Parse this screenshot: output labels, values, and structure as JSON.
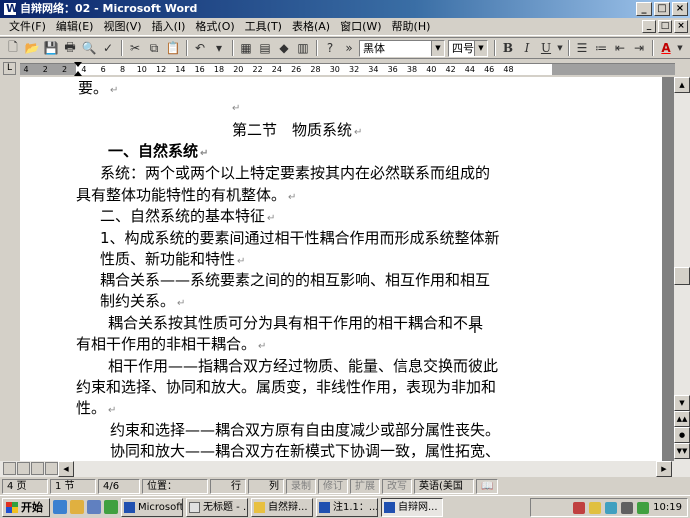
{
  "window": {
    "title": "自辩网络：02 - Microsoft Word",
    "buttons": [
      "_",
      "□",
      "×"
    ]
  },
  "menu": [
    "文件(F)",
    "编辑(E)",
    "视图(V)",
    "插入(I)",
    "格式(O)",
    "工具(T)",
    "表格(A)",
    "窗口(W)",
    "帮助(H)"
  ],
  "doc_buttons": [
    "_",
    "□",
    "×"
  ],
  "toolbar": {
    "font_name": "黑体",
    "font_size": "四号",
    "bold_label": "B",
    "italic_label": "I",
    "underline_label": "U",
    "font_color_label": "A"
  },
  "ruler": {
    "corner": "L",
    "ticks": [
      "4",
      "2",
      "2",
      "4",
      "6",
      "8",
      "10",
      "12",
      "14",
      "16",
      "18",
      "20",
      "22",
      "24",
      "26",
      "28",
      "30",
      "32",
      "34",
      "36",
      "38",
      "40",
      "42",
      "44",
      "46",
      "48"
    ]
  },
  "document": {
    "paragraph_mark": "↵",
    "lines": [
      {
        "text": "要。"
      },
      {
        "text": ""
      },
      {
        "text": "第二节　物质系统"
      },
      {
        "text": "一、自然系统"
      },
      {
        "text": "系统：两个或两个以上特定要素按其内在必然联系而组成的"
      },
      {
        "text": "具有整体功能特性的有机整体。"
      },
      {
        "text": "二、自然系统的基本特征"
      },
      {
        "text": "1、构成系统的要素间通过相干性耦合作用而形成系统整体新"
      },
      {
        "text": "性质、新功能和特性"
      },
      {
        "text": "耦合关系——系统要素之间的的相互影响、相互作用和相互"
      },
      {
        "text": "制约关系。"
      },
      {
        "text": "耦合关系按其性质可分为具有相干作用的相干耦合和不具"
      },
      {
        "text": "有相干作用的非相干耦合。"
      },
      {
        "text": "相干作用——指耦合双方经过物质、能量、信息交换而彼此"
      },
      {
        "text": "约束和选择、协同和放大。属质变，非线性作用，表现为非加和"
      },
      {
        "text": "性。"
      },
      {
        "text": "约束和选择——耦合双方原有自由度减少或部分属性丧失。"
      },
      {
        "text": "协同和放大——耦合双方在新模式下协调一致，属性拓宽、"
      }
    ]
  },
  "statusbar": {
    "page": "4 页",
    "section": "1 节",
    "page_of": "4/6",
    "position": "位置：",
    "line": "行",
    "column": "列",
    "rec": "录制",
    "trk": "修订",
    "ext": "扩展",
    "ovr": "改写",
    "language": "英语(美国"
  },
  "taskbar": {
    "start": "开始",
    "tasks": [
      {
        "label": "Microsoft...",
        "active": false
      },
      {
        "label": "无标题 - ...",
        "active": false
      },
      {
        "label": "自然辩...",
        "active": false
      },
      {
        "label": "注1.1：...",
        "active": false
      },
      {
        "label": "自辩网...",
        "active": true
      }
    ],
    "clock": "10:19"
  },
  "colors": {
    "titlebar": "#0a246a",
    "desktop_gray": "#d4d0c8"
  }
}
